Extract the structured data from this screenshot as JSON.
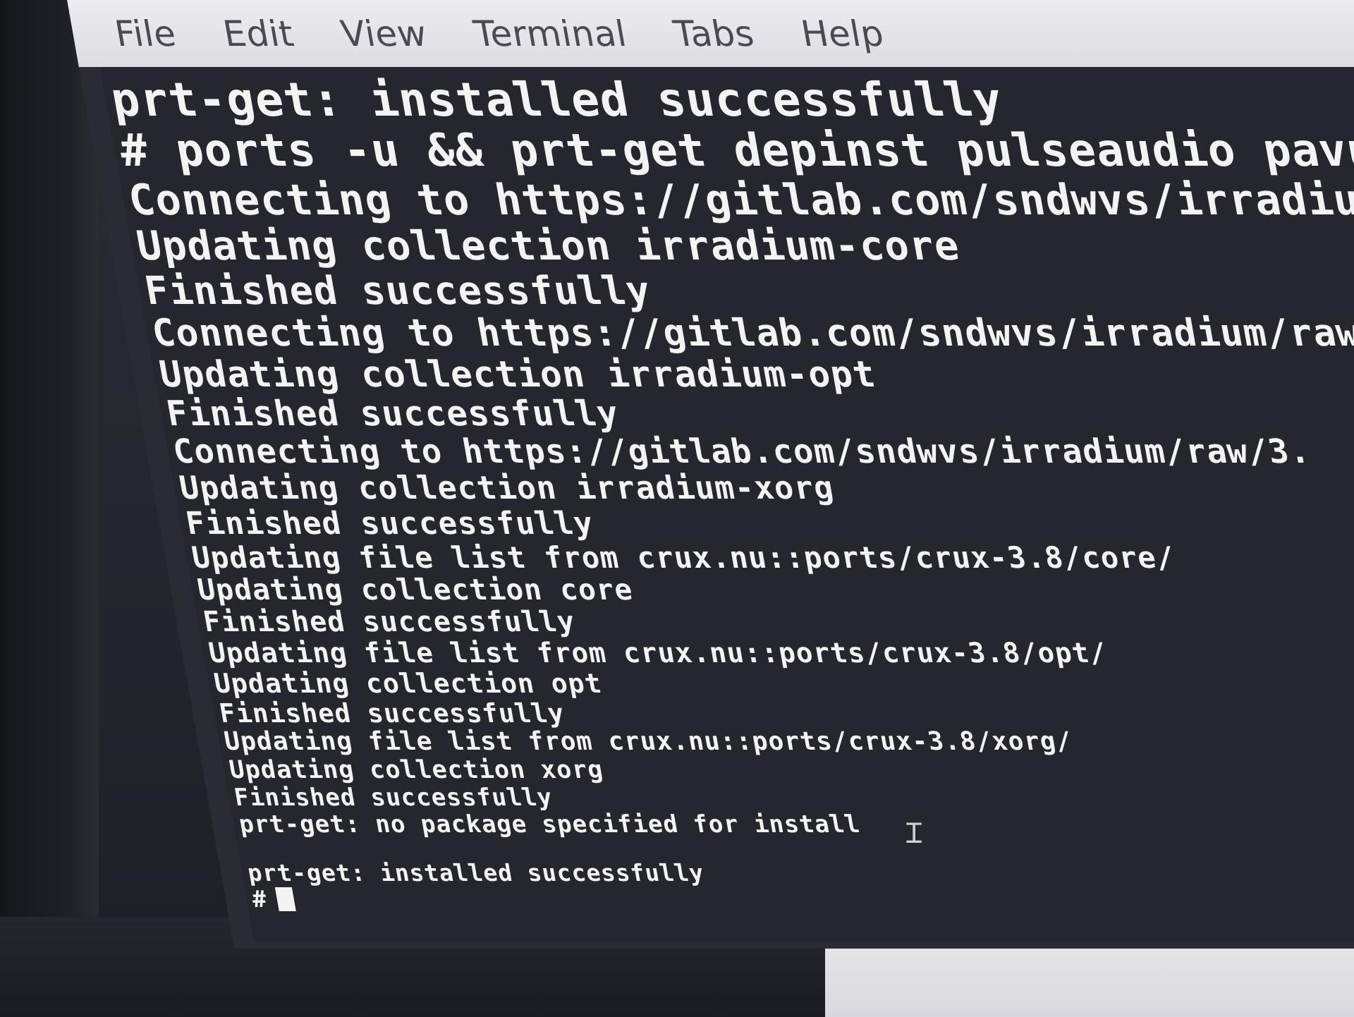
{
  "menubar": {
    "file": "File",
    "edit": "Edit",
    "view": "View",
    "terminal": "Terminal",
    "tabs": "Tabs",
    "help": "Help"
  },
  "terminal": {
    "lines": [
      "prt-get: installed successfully",
      "# ports -u && prt-get depinst pulseaudio pavucontro",
      "Connecting to https://gitlab.com/sndwvs/irradium/ra",
      "Updating collection irradium-core",
      "Finished successfully",
      "Connecting to https://gitlab.com/sndwvs/irradium/raw/",
      "Updating collection irradium-opt",
      "Finished successfully",
      "Connecting to https://gitlab.com/sndwvs/irradium/raw/3.",
      "Updating collection irradium-xorg",
      "Finished successfully",
      "Updating file list from crux.nu::ports/crux-3.8/core/",
      "Updating collection core",
      "Finished successfully",
      "Updating file list from crux.nu::ports/crux-3.8/opt/",
      "Updating collection opt",
      "Finished successfully",
      "Updating file list from crux.nu::ports/crux-3.8/xorg/",
      "Updating collection xorg",
      "Finished successfully",
      "prt-get: no package specified for install",
      "",
      "prt-get: installed successfully"
    ],
    "prompt": "#"
  },
  "icons": {
    "cursor": "text-cursor-icon",
    "block": "terminal-block-cursor"
  },
  "colors": {
    "terminal_bg": "#26272e",
    "terminal_fg": "#f3f3f3",
    "menubar_bg": "#e4e4ea"
  }
}
